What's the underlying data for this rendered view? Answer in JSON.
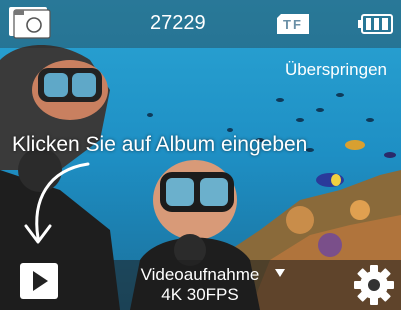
{
  "topbar": {
    "file_count": "27229",
    "storage_label": "TF",
    "album_icon": "album-icon",
    "battery_icon": "battery-full-icon"
  },
  "overlay": {
    "skip_label": "Überspringen",
    "hint_text": "Klicken Sie auf Album eingeben"
  },
  "bottombar": {
    "mode_name": "Videoaufnahme",
    "mode_detail": "4K 30FPS",
    "play_icon": "play-icon",
    "settings_icon": "gear-icon"
  },
  "colors": {
    "water": "#1e8fc4",
    "overlay_bar": "#282828"
  }
}
